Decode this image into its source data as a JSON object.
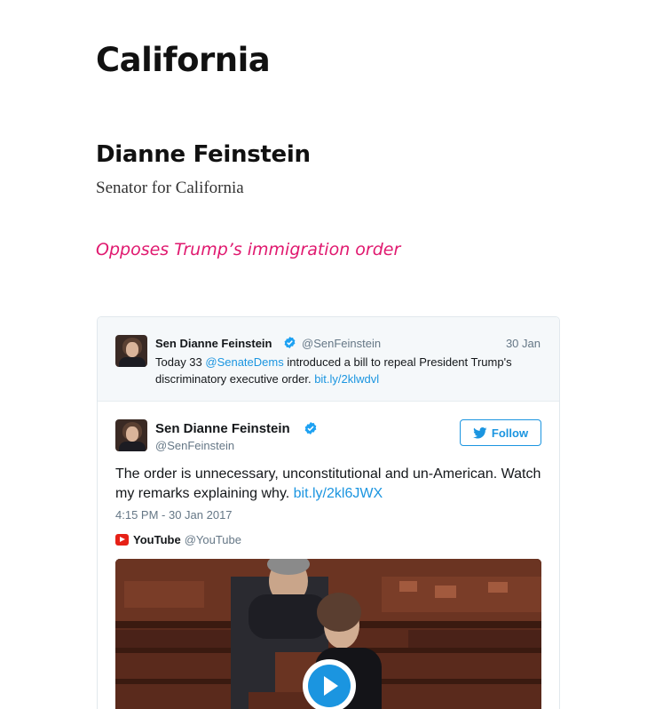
{
  "page": {
    "state": "California",
    "senator_name": "Dianne Feinstein",
    "senator_role": "Senator for California",
    "stance": "Opposes Trump’s immigration order"
  },
  "quoted_tweet": {
    "author_name": "Sen Dianne Feinstein",
    "handle": "@SenFeinstein",
    "date": "30 Jan",
    "text_prefix": "Today 33 ",
    "mention": "@SenateDems",
    "text_middle": " introduced a bill to repeal President Trump's discriminatory executive order. ",
    "link": "bit.ly/2klwdvl"
  },
  "tweet": {
    "author_name": "Sen Dianne Feinstein",
    "handle": "@SenFeinstein",
    "follow_label": "Follow",
    "text": "The order is unnecessary, unconstitutional and un-American. Watch my remarks explaining why. ",
    "link": "bit.ly/2kl6JWX",
    "timestamp": "4:15 PM - 30 Jan 2017",
    "media_source_name": "YouTube",
    "media_source_handle": "@YouTube"
  },
  "icons": {
    "verified": "verified-badge-icon",
    "twitter_bird": "twitter-bird-icon",
    "youtube": "youtube-icon",
    "play": "play-icon"
  },
  "colors": {
    "stance": "#e0196f",
    "twitter_blue": "#1b95e0",
    "youtube_red": "#e62117",
    "muted_text": "#657786"
  }
}
